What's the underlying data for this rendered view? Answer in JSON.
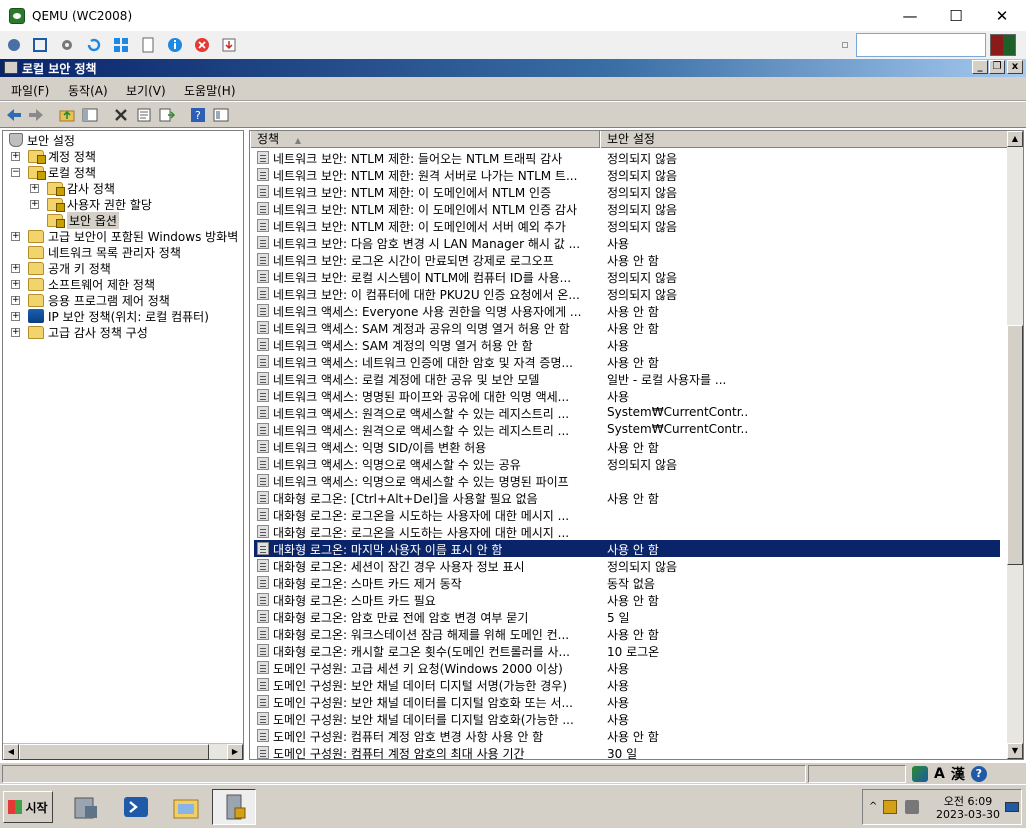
{
  "qemu": {
    "title": "QEMU (WC2008)",
    "minimize": "—",
    "maximize": "☐",
    "close": "✕"
  },
  "mmc": {
    "title": "로컬 보안 정책",
    "min": "_",
    "restore": "❐",
    "close": "x"
  },
  "menu": {
    "file": "파일(F)",
    "action": "동작(A)",
    "view": "보기(V)",
    "help": "도움말(H)"
  },
  "tree": {
    "root": "보안 설정",
    "items": [
      {
        "label": "계정 정책",
        "level": 1,
        "expander": "+",
        "icon": "folder-lock"
      },
      {
        "label": "로컬 정책",
        "level": 1,
        "expander": "−",
        "icon": "folder-lock"
      },
      {
        "label": "감사 정책",
        "level": 2,
        "expander": "+",
        "icon": "folder-lock"
      },
      {
        "label": "사용자 권한 할당",
        "level": 2,
        "expander": "+",
        "icon": "folder-lock"
      },
      {
        "label": "보안 옵션",
        "level": 2,
        "expander": "",
        "icon": "folder-lock",
        "selected": true
      },
      {
        "label": "고급 보안이 포함된 Windows 방화벽",
        "level": 1,
        "expander": "+",
        "icon": "folder"
      },
      {
        "label": "네트워크 목록 관리자 정책",
        "level": 1,
        "expander": "",
        "icon": "folder"
      },
      {
        "label": "공개 키 정책",
        "level": 1,
        "expander": "+",
        "icon": "folder"
      },
      {
        "label": "소프트웨어 제한 정책",
        "level": 1,
        "expander": "+",
        "icon": "folder"
      },
      {
        "label": "응용 프로그램 제어 정책",
        "level": 1,
        "expander": "+",
        "icon": "folder"
      },
      {
        "label": "IP 보안 정책(위치: 로컬 컴퓨터)",
        "level": 1,
        "expander": "+",
        "icon": "ip-security"
      },
      {
        "label": "고급 감사 정책 구성",
        "level": 1,
        "expander": "+",
        "icon": "folder"
      }
    ]
  },
  "list": {
    "col_policy": "정책",
    "col_setting": "보안 설정",
    "rows": [
      {
        "policy": "네트워크 보안: NTLM 제한: 들어오는 NTLM 트래픽 감사",
        "setting": "정의되지 않음"
      },
      {
        "policy": "네트워크 보안: NTLM 제한: 원격 서버로 나가는 NTLM 트...",
        "setting": "정의되지 않음"
      },
      {
        "policy": "네트워크 보안: NTLM 제한: 이 도메인에서 NTLM 인증",
        "setting": "정의되지 않음"
      },
      {
        "policy": "네트워크 보안: NTLM 제한: 이 도메인에서 NTLM 인증 감사",
        "setting": "정의되지 않음"
      },
      {
        "policy": "네트워크 보안: NTLM 제한: 이 도메인에서 서버 예외 추가",
        "setting": "정의되지 않음"
      },
      {
        "policy": "네트워크 보안: 다음 암호 변경 시 LAN Manager 해시 값 ...",
        "setting": "사용"
      },
      {
        "policy": "네트워크 보안: 로그온 시간이 만료되면 강제로 로그오프",
        "setting": "사용 안 함"
      },
      {
        "policy": "네트워크 보안: 로컬 시스템이 NTLM에 컴퓨터 ID를 사용...",
        "setting": "정의되지 않음"
      },
      {
        "policy": "네트워크 보안: 이 컴퓨터에 대한 PKU2U 인증 요청에서 온...",
        "setting": "정의되지 않음"
      },
      {
        "policy": "네트워크 액세스: Everyone 사용 권한을 익명 사용자에게 ...",
        "setting": "사용 안 함"
      },
      {
        "policy": "네트워크 액세스: SAM 계정과 공유의 익명 열거 허용 안 함",
        "setting": "사용 안 함"
      },
      {
        "policy": "네트워크 액세스: SAM 계정의 익명 열거 허용 안 함",
        "setting": "사용"
      },
      {
        "policy": "네트워크 액세스: 네트워크 인증에 대한 암호 및 자격 증명...",
        "setting": "사용 안 함"
      },
      {
        "policy": "네트워크 액세스: 로컬 계정에 대한 공유 및 보안 모델",
        "setting": "일반 - 로컬 사용자를 ..."
      },
      {
        "policy": "네트워크 액세스: 명명된 파이프와 공유에 대한 익명 액세...",
        "setting": "사용"
      },
      {
        "policy": "네트워크 액세스: 원격으로 액세스할 수 있는 레지스트리 ...",
        "setting": "System₩CurrentContr..."
      },
      {
        "policy": "네트워크 액세스: 원격으로 액세스할 수 있는 레지스트리 ...",
        "setting": "System₩CurrentContr..."
      },
      {
        "policy": "네트워크 액세스: 익명 SID/이름 변환 허용",
        "setting": "사용 안 함"
      },
      {
        "policy": "네트워크 액세스: 익명으로 액세스할 수 있는 공유",
        "setting": "정의되지 않음"
      },
      {
        "policy": "네트워크 액세스: 익명으로 액세스할 수 있는 명명된 파이프",
        "setting": ""
      },
      {
        "policy": "대화형 로그온: [Ctrl+Alt+Del]을 사용할 필요 없음",
        "setting": "사용 안 함"
      },
      {
        "policy": "대화형 로그온: 로그온을 시도하는 사용자에 대한 메시지 ...",
        "setting": ""
      },
      {
        "policy": "대화형 로그온: 로그온을 시도하는 사용자에 대한 메시지 ...",
        "setting": ""
      },
      {
        "policy": "대화형 로그온: 마지막 사용자 이름 표시 안 함",
        "setting": "사용 안 함",
        "selected": true
      },
      {
        "policy": "대화형 로그온: 세션이 잠긴 경우 사용자 정보 표시",
        "setting": "정의되지 않음"
      },
      {
        "policy": "대화형 로그온: 스마트 카드 제거 동작",
        "setting": "동작 없음"
      },
      {
        "policy": "대화형 로그온: 스마트 카드 필요",
        "setting": "사용 안 함"
      },
      {
        "policy": "대화형 로그온: 암호 만료 전에 암호 변경 여부 묻기",
        "setting": "5 일"
      },
      {
        "policy": "대화형 로그온: 워크스테이션 잠금 해제를 위해 도메인 컨...",
        "setting": "사용 안 함"
      },
      {
        "policy": "대화형 로그온: 캐시할 로그온 횟수(도메인 컨트롤러를 사...",
        "setting": "10 로그온"
      },
      {
        "policy": "도메인 구성원: 고급 세션 키 요청(Windows 2000 이상)",
        "setting": "사용"
      },
      {
        "policy": "도메인 구성원: 보안 채널 데이터 디지털 서명(가능한 경우)",
        "setting": "사용"
      },
      {
        "policy": "도메인 구성원: 보안 채널 데이터를 디지털 암호화 또는 서...",
        "setting": "사용"
      },
      {
        "policy": "도메인 구성원: 보안 채널 데이터를 디지털 암호화(가능한 ...",
        "setting": "사용"
      },
      {
        "policy": "도메인 구성원: 컴퓨터 계정 암호 변경 사항 사용 안 함",
        "setting": "사용 안 함"
      },
      {
        "policy": "도메인 구성원: 컴퓨터 계정 암호의 최대 사용 기간",
        "setting": "30 일"
      }
    ]
  },
  "statusbar": {
    "ime_a": "A",
    "ime_han": "漢",
    "help": "?"
  },
  "taskbar": {
    "start": "시작",
    "time": "오전 6:09",
    "date": "2023-03-30"
  },
  "colors": {
    "selection": "#0a246a",
    "title_gradient_start": "#0a246a"
  }
}
